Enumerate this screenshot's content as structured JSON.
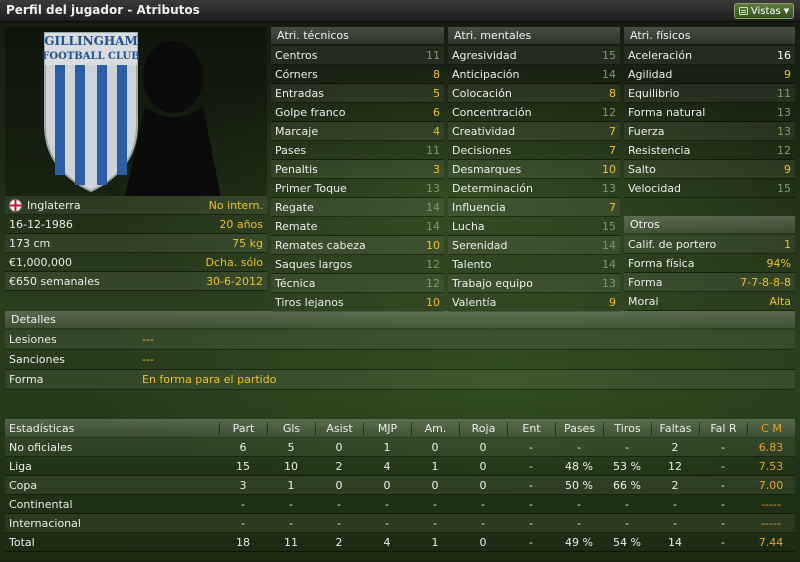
{
  "header": {
    "title": "Perfil del jugador - Atributos",
    "vistas_label": "Vistas",
    "vistas_arrow": "▼"
  },
  "club": {
    "crest_line1": "GILLINGHAM",
    "crest_line2": "FOOTBALL CLUB"
  },
  "player_info": [
    {
      "label": "Inglaterra",
      "value": "No intern.",
      "flag": "england-flag"
    },
    {
      "label": "16-12-1986",
      "value": "20 años"
    },
    {
      "label": "173 cm",
      "value": "75 kg"
    },
    {
      "label": "€1,000,000",
      "value": "Dcha. sólo"
    },
    {
      "label": "€650 semanales",
      "value": "30-6-2012"
    }
  ],
  "technical": {
    "header": "Atri. técnicos",
    "items": [
      {
        "name": "Centros",
        "value": "11"
      },
      {
        "name": "Córners",
        "value": "8"
      },
      {
        "name": "Entradas",
        "value": "5"
      },
      {
        "name": "Golpe franco",
        "value": "6"
      },
      {
        "name": "Marcaje",
        "value": "4"
      },
      {
        "name": "Pases",
        "value": "11"
      },
      {
        "name": "Penaltis",
        "value": "3"
      },
      {
        "name": "Primer Toque",
        "value": "13"
      },
      {
        "name": "Regate",
        "value": "14"
      },
      {
        "name": "Remate",
        "value": "14"
      },
      {
        "name": "Remates cabeza",
        "value": "10"
      },
      {
        "name": "Saques largos",
        "value": "12"
      },
      {
        "name": "Técnica",
        "value": "12"
      },
      {
        "name": "Tiros lejanos",
        "value": "10"
      }
    ]
  },
  "mental": {
    "header": "Atri. mentales",
    "items": [
      {
        "name": "Agresividad",
        "value": "15"
      },
      {
        "name": "Anticipación",
        "value": "14"
      },
      {
        "name": "Colocación",
        "value": "8"
      },
      {
        "name": "Concentración",
        "value": "12"
      },
      {
        "name": "Creatividad",
        "value": "7"
      },
      {
        "name": "Decisiones",
        "value": "7"
      },
      {
        "name": "Desmarques",
        "value": "10"
      },
      {
        "name": "Determinación",
        "value": "13"
      },
      {
        "name": "Influencia",
        "value": "7"
      },
      {
        "name": "Lucha",
        "value": "15"
      },
      {
        "name": "Serenidad",
        "value": "14"
      },
      {
        "name": "Talento",
        "value": "14"
      },
      {
        "name": "Trabajo equipo",
        "value": "13"
      },
      {
        "name": "Valentía",
        "value": "9"
      }
    ]
  },
  "physical": {
    "header": "Atri. físicos",
    "items": [
      {
        "name": "Aceleración",
        "value": "16"
      },
      {
        "name": "Agilidad",
        "value": "9"
      },
      {
        "name": "Equilibrio",
        "value": "11"
      },
      {
        "name": "Forma natural",
        "value": "13"
      },
      {
        "name": "Fuerza",
        "value": "13"
      },
      {
        "name": "Resistencia",
        "value": "12"
      },
      {
        "name": "Salto",
        "value": "9"
      },
      {
        "name": "Velocidad",
        "value": "15"
      }
    ]
  },
  "otros": {
    "header": "Otros",
    "items": [
      {
        "name": "Calif. de portero",
        "value": "1"
      },
      {
        "name": "Forma física",
        "value": "94%"
      },
      {
        "name": "Forma",
        "value": "7-7-8-8-8"
      },
      {
        "name": "Moral",
        "value": "Alta"
      }
    ]
  },
  "detalles": {
    "header": "Detalles",
    "items": [
      {
        "label": "Lesiones",
        "value": "---"
      },
      {
        "label": "Sanciones",
        "value": "---"
      },
      {
        "label": "Forma",
        "value": "En forma para el partido"
      }
    ]
  },
  "stats": {
    "columns": [
      "Estadísticas",
      "Part",
      "Gls",
      "Asist",
      "MJP",
      "Am.",
      "Roja",
      "Ent",
      "Pases",
      "Tiros",
      "Faltas",
      "Fal R",
      "C M"
    ],
    "rows": [
      [
        "No oficiales",
        "6",
        "5",
        "0",
        "1",
        "0",
        "0",
        "-",
        "-",
        "-",
        "2",
        "-",
        "6.83"
      ],
      [
        "Liga",
        "15",
        "10",
        "2",
        "4",
        "1",
        "0",
        "-",
        "48 %",
        "53 %",
        "12",
        "-",
        "7.53"
      ],
      [
        "Copa",
        "3",
        "1",
        "0",
        "0",
        "0",
        "0",
        "-",
        "50 %",
        "66 %",
        "2",
        "-",
        "7.00"
      ],
      [
        "Continental",
        "-",
        "-",
        "-",
        "-",
        "-",
        "-",
        "-",
        "-",
        "-",
        "-",
        "-",
        "-----"
      ],
      [
        "Internacional",
        "-",
        "-",
        "-",
        "-",
        "-",
        "-",
        "-",
        "-",
        "-",
        "-",
        "-",
        "-----"
      ],
      [
        "Total",
        "18",
        "11",
        "2",
        "4",
        "1",
        "0",
        "-",
        "49 %",
        "54 %",
        "14",
        "-",
        "7.44"
      ]
    ]
  },
  "colors": {
    "accent": "#f0c020",
    "rating": "#e8a020",
    "muted": "#7a9a6a"
  }
}
